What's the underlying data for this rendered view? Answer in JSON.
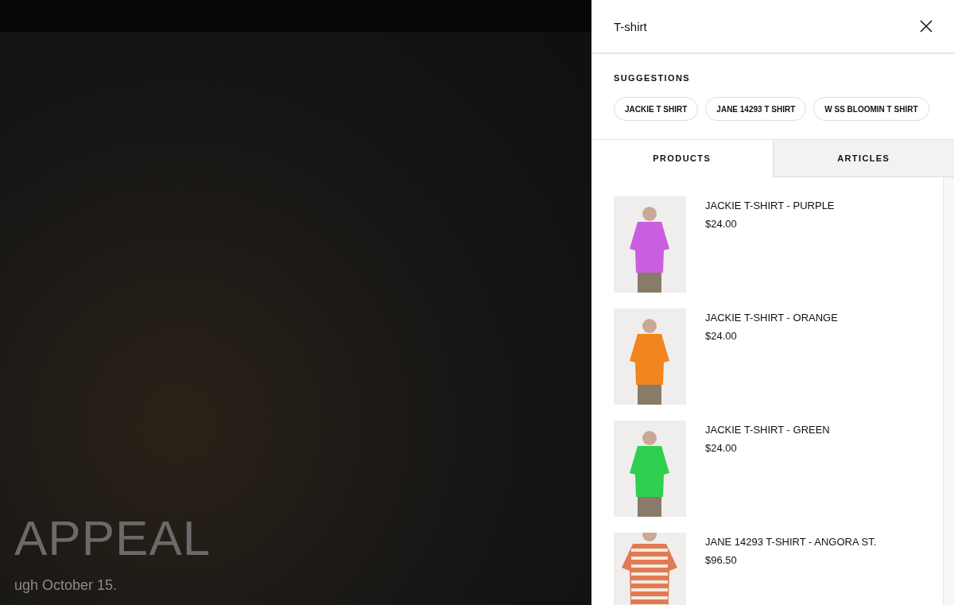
{
  "background": {
    "headline": "APPEAL",
    "subline": "ugh October 15."
  },
  "search": {
    "value": "T-shirt"
  },
  "suggestions": {
    "title": "SUGGESTIONS",
    "items": [
      "JACKIE T SHIRT",
      "JANE 14293 T SHIRT",
      "W SS BLOOMIN T SHIRT"
    ]
  },
  "tabs": [
    {
      "label": "PRODUCTS",
      "selected": true
    },
    {
      "label": "ARTICLES",
      "selected": false
    }
  ],
  "products": [
    {
      "name": "JACKIE T-SHIRT - PURPLE",
      "price": "$24.00",
      "color": "#c95ee0",
      "kind": "plain"
    },
    {
      "name": "JACKIE T-SHIRT - ORANGE",
      "price": "$24.00",
      "color": "#f2851f",
      "kind": "plain"
    },
    {
      "name": "JACKIE T-SHIRT - GREEN",
      "price": "$24.00",
      "color": "#2fcf4f",
      "kind": "plain"
    },
    {
      "name": "JANE 14293 T-SHIRT - ANGORA ST.",
      "price": "$96.50",
      "color": "#e07a55",
      "kind": "striped"
    }
  ]
}
